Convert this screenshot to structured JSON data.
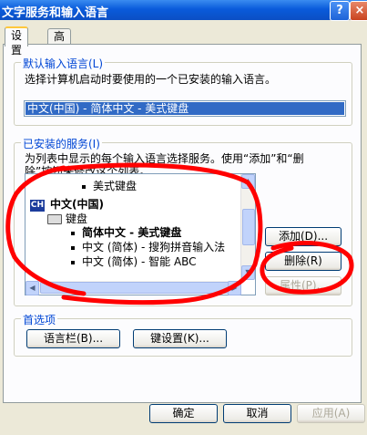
{
  "window": {
    "title": "文字服务和输入语言",
    "help_glyph": "?",
    "close_glyph": "×"
  },
  "tabs": [
    {
      "label": "设置",
      "active": true
    },
    {
      "label": "高级",
      "active": false
    }
  ],
  "default_language": {
    "legend": "默认输入语言(L)",
    "description": "选择计算机启动时要使用的一个已安装的输入语言。",
    "selected": "中文(中国) - 简体中文 - 美式键盘"
  },
  "installed_services": {
    "legend": "已安装的服务(I)",
    "description_line1": "为列表中显示的每个输入语言选择服务。使用“添加”和“删",
    "description_line2": "除”按钮来修改这个列表。",
    "items": {
      "us_keyboard_top": "美式键盘",
      "lang_badge": "CH",
      "language": "中文(中国)",
      "keyboard_group": "键盘",
      "service_1": "简体中文 - 美式键盘",
      "service_2": "中文 (简体) - 搜狗拼音输入法",
      "service_3": "中文 (简体) - 智能 ABC"
    },
    "buttons": {
      "add": "添加(D)...",
      "remove": "删除(R)",
      "properties": "属性(P)..."
    }
  },
  "preferences": {
    "legend": "首选项",
    "language_bar": "语言栏(B)...",
    "key_settings": "键设置(K)..."
  },
  "footer": {
    "ok": "确定",
    "cancel": "取消",
    "apply": "应用(A)"
  },
  "colors": {
    "titlebar": "#0A5BDB",
    "selection": "#316AC5",
    "legend": "#0046D5",
    "annotation": "#FF0000"
  }
}
